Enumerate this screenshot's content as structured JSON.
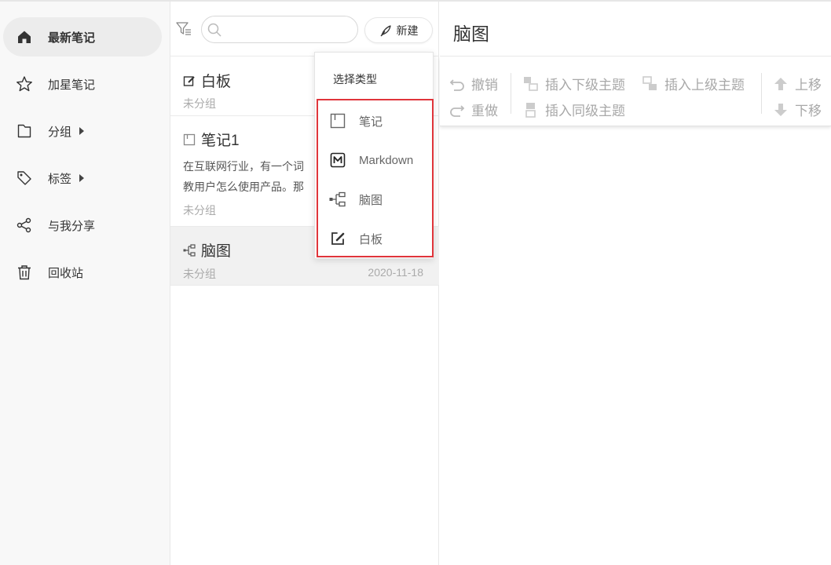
{
  "sidebar": {
    "items": [
      {
        "label": "最新笔记",
        "icon": "home-icon"
      },
      {
        "label": "加星笔记",
        "icon": "star-icon"
      },
      {
        "label": "分组",
        "icon": "folder-icon"
      },
      {
        "label": "标签",
        "icon": "tag-icon"
      },
      {
        "label": "与我分享",
        "icon": "share-icon"
      },
      {
        "label": "回收站",
        "icon": "trash-icon"
      }
    ]
  },
  "list": {
    "search_placeholder": "",
    "new_label": "新建",
    "notes": [
      {
        "title": "白板",
        "icon": "whiteboard-icon",
        "group": "未分组"
      },
      {
        "title": "笔记1",
        "icon": "note-icon",
        "excerpt_1": "在互联网行业，有一个词",
        "excerpt_2": "教用户怎么使用产品。那",
        "group": "未分组"
      },
      {
        "title": "脑图",
        "icon": "mindmap-icon",
        "group": "未分组",
        "date": "2020-11-18"
      }
    ]
  },
  "dropdown": {
    "title": "选择类型",
    "options": [
      {
        "label": "笔记",
        "icon": "note-icon"
      },
      {
        "label": "Markdown",
        "icon": "markdown-icon"
      },
      {
        "label": "脑图",
        "icon": "mindmap-icon"
      },
      {
        "label": "白板",
        "icon": "whiteboard-icon"
      }
    ],
    "highlight_color": "#e0353b"
  },
  "editor": {
    "title": "脑图",
    "toolbar": {
      "undo": "撤销",
      "redo": "重做",
      "insert_child": "插入下级主题",
      "insert_sibling": "插入同级主题",
      "insert_parent": "插入上级主题",
      "move_up": "上移",
      "move_down": "下移"
    }
  }
}
